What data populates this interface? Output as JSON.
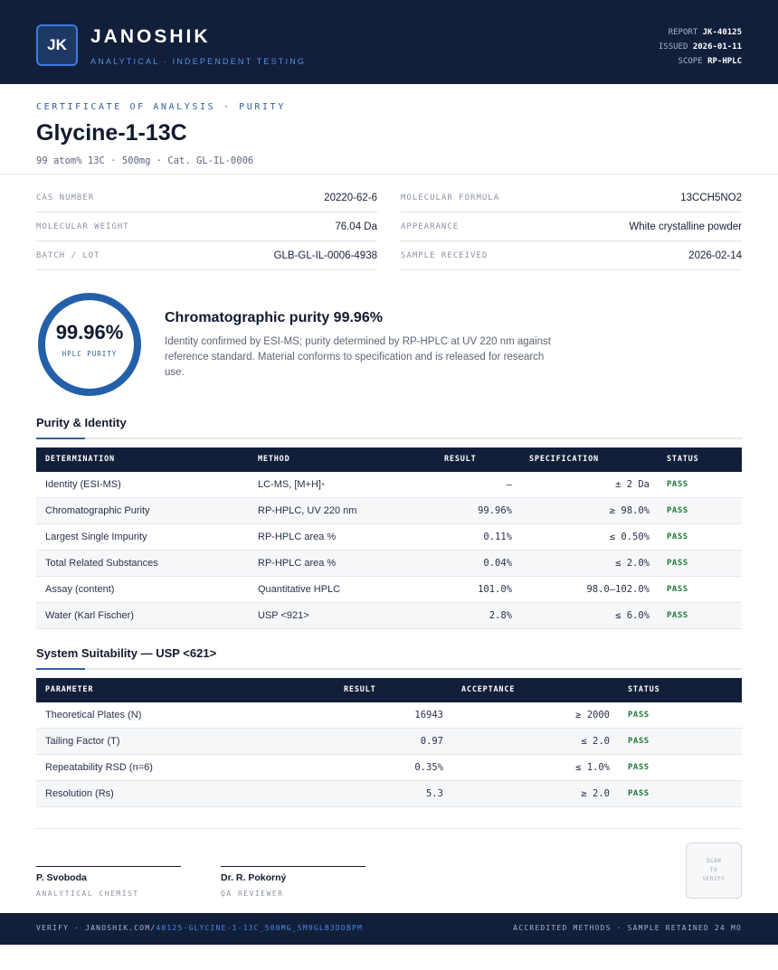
{
  "header": {
    "logo_initials": "JK",
    "brand": "JANOSHIK",
    "tagline": "ANALYTICAL · INDEPENDENT TESTING",
    "report_label": "REPORT",
    "report_value": "JK-40125",
    "issued_label": "ISSUED",
    "issued_value": "2026-01-11",
    "scope_label": "SCOPE",
    "scope_value": "RP-HPLC"
  },
  "document": {
    "kicker": "CERTIFICATE OF ANALYSIS · PURITY",
    "product": "Glycine-1-13C",
    "subline": "99 atom% 13C · 500mg  ·  Cat. GL-IL-0006"
  },
  "properties": {
    "cas_label": "CAS NUMBER",
    "cas_value": "20220-62-6",
    "formula_label": "MOLECULAR FORMULA",
    "formula_value": "13CCH5NO2",
    "mw_label": "MOLECULAR WEIGHT",
    "mw_value": "76.04 Da",
    "appearance_label": "APPEARANCE",
    "appearance_value": "White crystalline powder",
    "batch_label": "BATCH / LOT",
    "batch_value": "GLB-GL-IL-0006-4938",
    "received_label": "SAMPLE RECEIVED",
    "received_value": "2026-02-14"
  },
  "purity": {
    "value": "99.96%",
    "fraction": 0.9996,
    "label": "HPLC PURITY",
    "title": "Chromatographic purity 99.96%",
    "description": "Identity confirmed by ESI-MS; purity determined by RP-HPLC at UV 220 nm against reference standard. Material conforms to specification and is released for research use."
  },
  "purity_identity": {
    "title": "Purity & Identity",
    "headers": {
      "determination": "DETERMINATION",
      "method": "METHOD",
      "result": "RESULT",
      "specification": "SPECIFICATION",
      "status": "STATUS"
    },
    "rows": [
      {
        "determination": "Identity (ESI-MS)",
        "method": "LC-MS, [M+H]",
        "method_sup": "+",
        "result": "–",
        "specification": "± 2 Da",
        "status": "PASS"
      },
      {
        "determination": "Chromatographic Purity",
        "method": "RP-HPLC, UV 220 nm",
        "result": "99.96%",
        "specification": "≥ 98.0%",
        "status": "PASS"
      },
      {
        "determination": "Largest Single Impurity",
        "method": "RP-HPLC area %",
        "result": "0.11%",
        "specification": "≤ 0.50%",
        "status": "PASS"
      },
      {
        "determination": "Total Related Substances",
        "method": "RP-HPLC area %",
        "result": "0.04%",
        "specification": "≤ 2.0%",
        "status": "PASS"
      },
      {
        "determination": "Assay (content)",
        "method": "Quantitative HPLC",
        "result": "101.0%",
        "specification": "98.0–102.0%",
        "status": "PASS"
      },
      {
        "determination": "Water (Karl Fischer)",
        "method": "USP <921>",
        "result": "2.8%",
        "specification": "≤ 6.0%",
        "status": "PASS"
      }
    ]
  },
  "system_suitability": {
    "title": "System Suitability — USP <621>",
    "headers": {
      "parameter": "PARAMETER",
      "result": "RESULT",
      "acceptance": "ACCEPTANCE",
      "status": "STATUS"
    },
    "rows": [
      {
        "parameter": "Theoretical Plates (N)",
        "result": "16943",
        "acceptance": "≥ 2000",
        "status": "PASS"
      },
      {
        "parameter": "Tailing Factor (T)",
        "result": "0.97",
        "acceptance": "≤ 2.0",
        "status": "PASS"
      },
      {
        "parameter": "Repeatability RSD (n=6)",
        "result": "0.35%",
        "acceptance": "≤ 1.0%",
        "status": "PASS"
      },
      {
        "parameter": "Resolution (Rs)",
        "result": "5.3",
        "acceptance": "≥ 2.0",
        "status": "PASS"
      }
    ]
  },
  "signatures": [
    {
      "name": "P. Svoboda",
      "role": "ANALYTICAL CHEMIST"
    },
    {
      "name": "Dr. R. Pokorný",
      "role": "QA REVIEWER"
    }
  ],
  "qr": {
    "line1": "SCAN",
    "line2": "TO",
    "line3": "VERIFY"
  },
  "footer": {
    "verify_prefix": "VERIFY · JANOSHIK.COM/",
    "verify_path": "40125-GLYCINE-1-13C_500MG_SM9GLB3DDBPM",
    "right_text": "ACCREDITED METHODS · SAMPLE RETAINED 24 MO"
  },
  "colors": {
    "navy": "#121f3a",
    "accent_blue": "#2460aa",
    "pass_green": "#1f7a3a"
  }
}
